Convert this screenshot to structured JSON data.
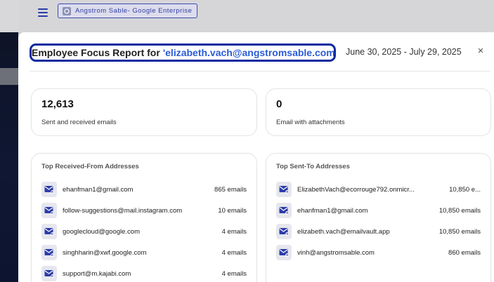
{
  "app": {
    "org_chip_label": "Angstrom Sable- Google Enterprise"
  },
  "header": {
    "title_prefix": "Employee Focus Report for",
    "title_email": "'elizabeth.vach@angstromsable.com",
    "date_range": "June 30, 2025 - July 29, 2025",
    "close_glyph": "×"
  },
  "stats": {
    "sent_received": {
      "value": "12,613",
      "label": "Sent and received emails"
    },
    "attachments": {
      "value": "0",
      "label": "Email with attachments"
    }
  },
  "received_from": {
    "title": "Top Received-From Addresses",
    "rows": [
      {
        "address": "ehanfman1@gmail.com",
        "count": "865 emails"
      },
      {
        "address": "follow-suggestions@mail.instagram.com",
        "count": "10 emails"
      },
      {
        "address": "googlecloud@google.com",
        "count": "4 emails"
      },
      {
        "address": "singhharin@xwf.google.com",
        "count": "4 emails"
      },
      {
        "address": "support@m.kajabi.com",
        "count": "4 emails"
      }
    ]
  },
  "sent_to": {
    "title": "Top Sent-To Addresses",
    "rows": [
      {
        "address": "ElizabethVach@ecorrouge792.onmicr...",
        "count": "10,850 e..."
      },
      {
        "address": "ehanfman1@gmail.com",
        "count": "10,850 emails"
      },
      {
        "address": "elizabeth.vach@emailvault.app",
        "count": "10,850 emails"
      },
      {
        "address": "vinh@angstromsable.com",
        "count": "860 emails"
      }
    ]
  },
  "icons": {
    "menu": "hamburger-menu-icon",
    "org": "organization-icon",
    "received_row": "mail-received-icon",
    "sent_row": "mail-sent-icon",
    "close": "close-icon"
  },
  "colors": {
    "accent": "#2a5bd7",
    "title_outline": "#0a2aa0",
    "mail_icon": "#2c3ca8"
  }
}
